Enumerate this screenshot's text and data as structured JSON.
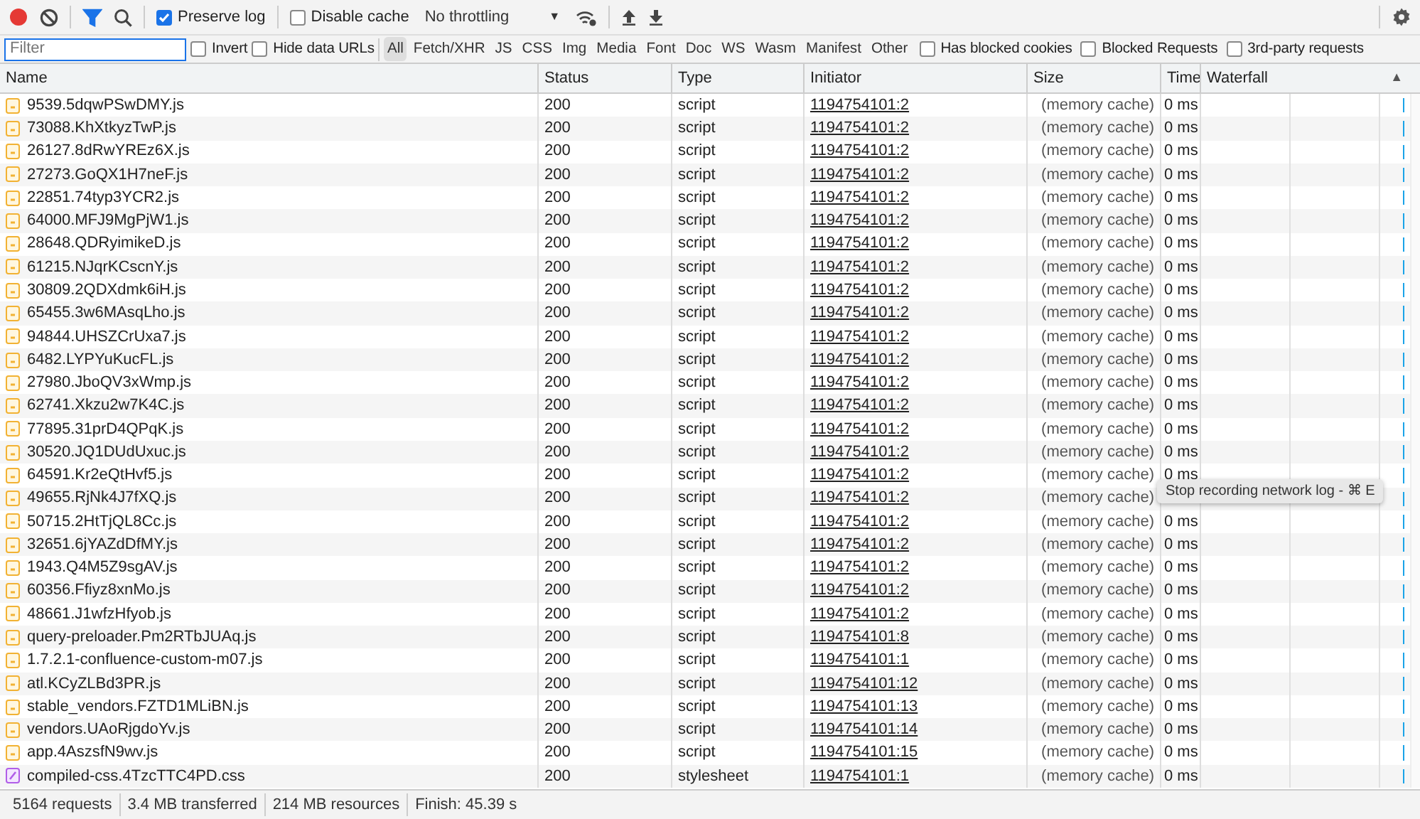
{
  "toolbar": {
    "recording": true,
    "filter_active": true,
    "preserve_log": {
      "label": "Preserve log",
      "checked": true
    },
    "disable_cache": {
      "label": "Disable cache",
      "checked": false
    },
    "throttling": {
      "value": "No throttling",
      "caret": "▼"
    }
  },
  "filter_bar": {
    "placeholder": "Filter",
    "checkboxes_left": [
      {
        "label": "Invert",
        "checked": false
      },
      {
        "label": "Hide data URLs",
        "checked": false
      }
    ],
    "types": [
      {
        "label": "All",
        "selected": true
      },
      {
        "label": "Fetch/XHR",
        "selected": false
      },
      {
        "label": "JS",
        "selected": false
      },
      {
        "label": "CSS",
        "selected": false
      },
      {
        "label": "Img",
        "selected": false
      },
      {
        "label": "Media",
        "selected": false
      },
      {
        "label": "Font",
        "selected": false
      },
      {
        "label": "Doc",
        "selected": false
      },
      {
        "label": "WS",
        "selected": false
      },
      {
        "label": "Wasm",
        "selected": false
      },
      {
        "label": "Manifest",
        "selected": false
      },
      {
        "label": "Other",
        "selected": false
      }
    ],
    "checkboxes_right": [
      {
        "label": "Has blocked cookies",
        "checked": false
      },
      {
        "label": "Blocked Requests",
        "checked": false
      },
      {
        "label": "3rd-party requests",
        "checked": false
      }
    ]
  },
  "table": {
    "columns": [
      "Name",
      "Status",
      "Type",
      "Initiator",
      "Size",
      "Time",
      "Waterfall"
    ],
    "sort_indicator": "▲",
    "rows": [
      {
        "kind": "script",
        "name": "9539.5dqwPSwDMY.js",
        "status": "200",
        "type": "script",
        "initiator": "1194754101:2",
        "size": "(memory cache)",
        "time": "0 ms"
      },
      {
        "kind": "script",
        "name": "73088.KhXtkyzTwP.js",
        "status": "200",
        "type": "script",
        "initiator": "1194754101:2",
        "size": "(memory cache)",
        "time": "0 ms"
      },
      {
        "kind": "script",
        "name": "26127.8dRwYREz6X.js",
        "status": "200",
        "type": "script",
        "initiator": "1194754101:2",
        "size": "(memory cache)",
        "time": "0 ms"
      },
      {
        "kind": "script",
        "name": "27273.GoQX1H7neF.js",
        "status": "200",
        "type": "script",
        "initiator": "1194754101:2",
        "size": "(memory cache)",
        "time": "0 ms"
      },
      {
        "kind": "script",
        "name": "22851.74typ3YCR2.js",
        "status": "200",
        "type": "script",
        "initiator": "1194754101:2",
        "size": "(memory cache)",
        "time": "0 ms"
      },
      {
        "kind": "script",
        "name": "64000.MFJ9MgPjW1.js",
        "status": "200",
        "type": "script",
        "initiator": "1194754101:2",
        "size": "(memory cache)",
        "time": "0 ms"
      },
      {
        "kind": "script",
        "name": "28648.QDRyimikeD.js",
        "status": "200",
        "type": "script",
        "initiator": "1194754101:2",
        "size": "(memory cache)",
        "time": "0 ms"
      },
      {
        "kind": "script",
        "name": "61215.NJqrKCscnY.js",
        "status": "200",
        "type": "script",
        "initiator": "1194754101:2",
        "size": "(memory cache)",
        "time": "0 ms"
      },
      {
        "kind": "script",
        "name": "30809.2QDXdmk6iH.js",
        "status": "200",
        "type": "script",
        "initiator": "1194754101:2",
        "size": "(memory cache)",
        "time": "0 ms"
      },
      {
        "kind": "script",
        "name": "65455.3w6MAsqLho.js",
        "status": "200",
        "type": "script",
        "initiator": "1194754101:2",
        "size": "(memory cache)",
        "time": "0 ms"
      },
      {
        "kind": "script",
        "name": "94844.UHSZCrUxa7.js",
        "status": "200",
        "type": "script",
        "initiator": "1194754101:2",
        "size": "(memory cache)",
        "time": "0 ms"
      },
      {
        "kind": "script",
        "name": "6482.LYPYuKucFL.js",
        "status": "200",
        "type": "script",
        "initiator": "1194754101:2",
        "size": "(memory cache)",
        "time": "0 ms"
      },
      {
        "kind": "script",
        "name": "27980.JboQV3xWmp.js",
        "status": "200",
        "type": "script",
        "initiator": "1194754101:2",
        "size": "(memory cache)",
        "time": "0 ms"
      },
      {
        "kind": "script",
        "name": "62741.Xkzu2w7K4C.js",
        "status": "200",
        "type": "script",
        "initiator": "1194754101:2",
        "size": "(memory cache)",
        "time": "0 ms"
      },
      {
        "kind": "script",
        "name": "77895.31prD4QPqK.js",
        "status": "200",
        "type": "script",
        "initiator": "1194754101:2",
        "size": "(memory cache)",
        "time": "0 ms"
      },
      {
        "kind": "script",
        "name": "30520.JQ1DUdUxuc.js",
        "status": "200",
        "type": "script",
        "initiator": "1194754101:2",
        "size": "(memory cache)",
        "time": "0 ms"
      },
      {
        "kind": "script",
        "name": "64591.Kr2eQtHvf5.js",
        "status": "200",
        "type": "script",
        "initiator": "1194754101:2",
        "size": "(memory cache)",
        "time": "0 ms"
      },
      {
        "kind": "script",
        "name": "49655.RjNk4J7fXQ.js",
        "status": "200",
        "type": "script",
        "initiator": "1194754101:2",
        "size": "(memory cache)"
      },
      {
        "kind": "script",
        "name": "50715.2HtTjQL8Cc.js",
        "status": "200",
        "type": "script",
        "initiator": "1194754101:2",
        "size": "(memory cache)",
        "time": "0 ms"
      },
      {
        "kind": "script",
        "name": "32651.6jYAZdDfMY.js",
        "status": "200",
        "type": "script",
        "initiator": "1194754101:2",
        "size": "(memory cache)",
        "time": "0 ms"
      },
      {
        "kind": "script",
        "name": "1943.Q4M5Z9sgAV.js",
        "status": "200",
        "type": "script",
        "initiator": "1194754101:2",
        "size": "(memory cache)",
        "time": "0 ms"
      },
      {
        "kind": "script",
        "name": "60356.Ffiyz8xnMo.js",
        "status": "200",
        "type": "script",
        "initiator": "1194754101:2",
        "size": "(memory cache)",
        "time": "0 ms"
      },
      {
        "kind": "script",
        "name": "48661.J1wfzHfyob.js",
        "status": "200",
        "type": "script",
        "initiator": "1194754101:2",
        "size": "(memory cache)",
        "time": "0 ms"
      },
      {
        "kind": "script",
        "name": "query-preloader.Pm2RTbJUAq.js",
        "status": "200",
        "type": "script",
        "initiator": "1194754101:8",
        "size": "(memory cache)",
        "time": "0 ms"
      },
      {
        "kind": "script",
        "name": "1.7.2.1-confluence-custom-m07.js",
        "status": "200",
        "type": "script",
        "initiator": "1194754101:1",
        "size": "(memory cache)",
        "time": "0 ms"
      },
      {
        "kind": "script",
        "name": "atl.KCyZLBd3PR.js",
        "status": "200",
        "type": "script",
        "initiator": "1194754101:12",
        "size": "(memory cache)",
        "time": "0 ms"
      },
      {
        "kind": "script",
        "name": "stable_vendors.FZTD1MLiBN.js",
        "status": "200",
        "type": "script",
        "initiator": "1194754101:13",
        "size": "(memory cache)",
        "time": "0 ms"
      },
      {
        "kind": "script",
        "name": "vendors.UAoRjgdoYv.js",
        "status": "200",
        "type": "script",
        "initiator": "1194754101:14",
        "size": "(memory cache)",
        "time": "0 ms"
      },
      {
        "kind": "script",
        "name": "app.4AszsfN9wv.js",
        "status": "200",
        "type": "script",
        "initiator": "1194754101:15",
        "size": "(memory cache)",
        "time": "0 ms"
      },
      {
        "kind": "stylesheet",
        "name": "compiled-css.4TzcTTC4PD.css",
        "status": "200",
        "type": "stylesheet",
        "initiator": "1194754101:1",
        "size": "(memory cache)",
        "time": "0 ms"
      }
    ]
  },
  "tooltip": "Stop recording network log - ⌘ E",
  "status_bar": [
    "5164 requests",
    "3.4 MB transferred",
    "214 MB resources",
    "Finish: 45.39 s"
  ]
}
